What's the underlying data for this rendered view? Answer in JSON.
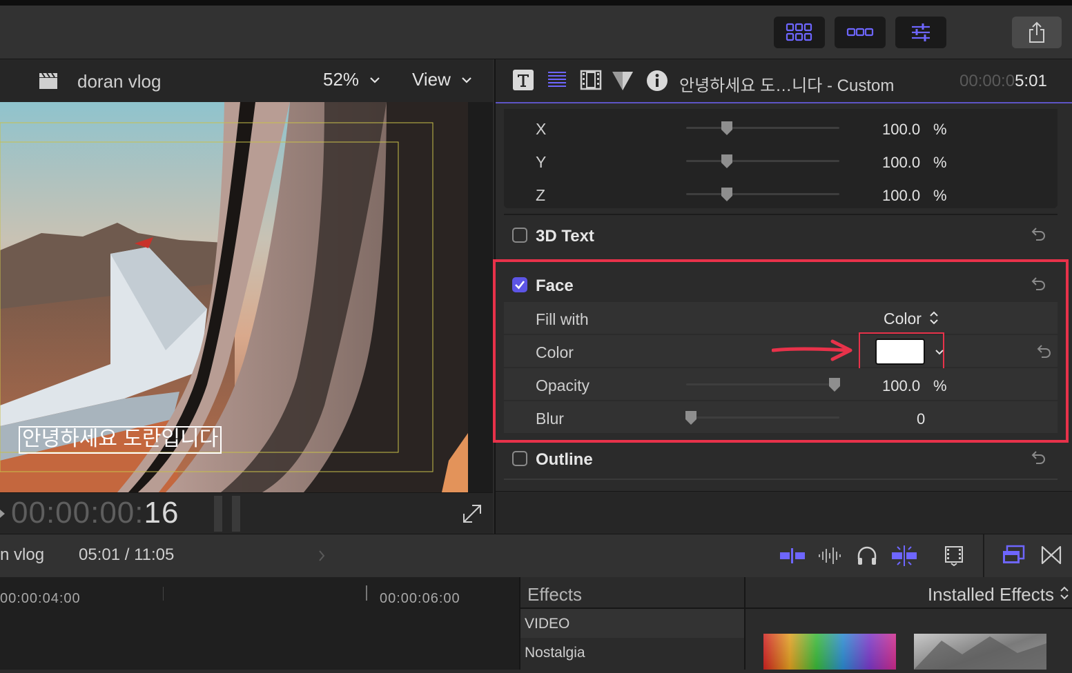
{
  "toolbar": {
    "buttons": [
      "browser-icon",
      "timeline-icon",
      "inspector-icon"
    ],
    "share_icon": "share-icon"
  },
  "viewer": {
    "project_title": "doran vlog",
    "zoom": "52%",
    "view_label": "View",
    "title_text": "안녕하세요 도란입니다",
    "timecode_dim": "00:00:00:",
    "timecode_bright": "16"
  },
  "inspector": {
    "title": "안녕하세요 도…니다 - Custom",
    "timecode_dim": "00:00:0",
    "timecode_bright": "5:01",
    "scale_rows": [
      {
        "label": "X",
        "value": "100.0",
        "unit": "%"
      },
      {
        "label": "Y",
        "value": "100.0",
        "unit": "%"
      },
      {
        "label": "Z",
        "value": "100.0",
        "unit": "%"
      }
    ],
    "section_3d": "3D Text",
    "section_face": "Face",
    "fill_with_label": "Fill with",
    "fill_with_value": "Color",
    "color_label": "Color",
    "opacity_label": "Opacity",
    "opacity_value": "100.0",
    "opacity_unit": "%",
    "blur_label": "Blur",
    "blur_value": "0",
    "section_outline": "Outline",
    "face_checked": true,
    "swatch_color": "#ffffff",
    "highlight_color": "#e8324a"
  },
  "timeline": {
    "project": "n vlog",
    "duration": "05:01 / 11:05",
    "ruler": [
      "00:00:04:00",
      "00:00:06:00"
    ]
  },
  "effects": {
    "title": "Effects",
    "installed": "Installed Effects",
    "categories": [
      "VIDEO",
      "Nostalgia"
    ]
  }
}
